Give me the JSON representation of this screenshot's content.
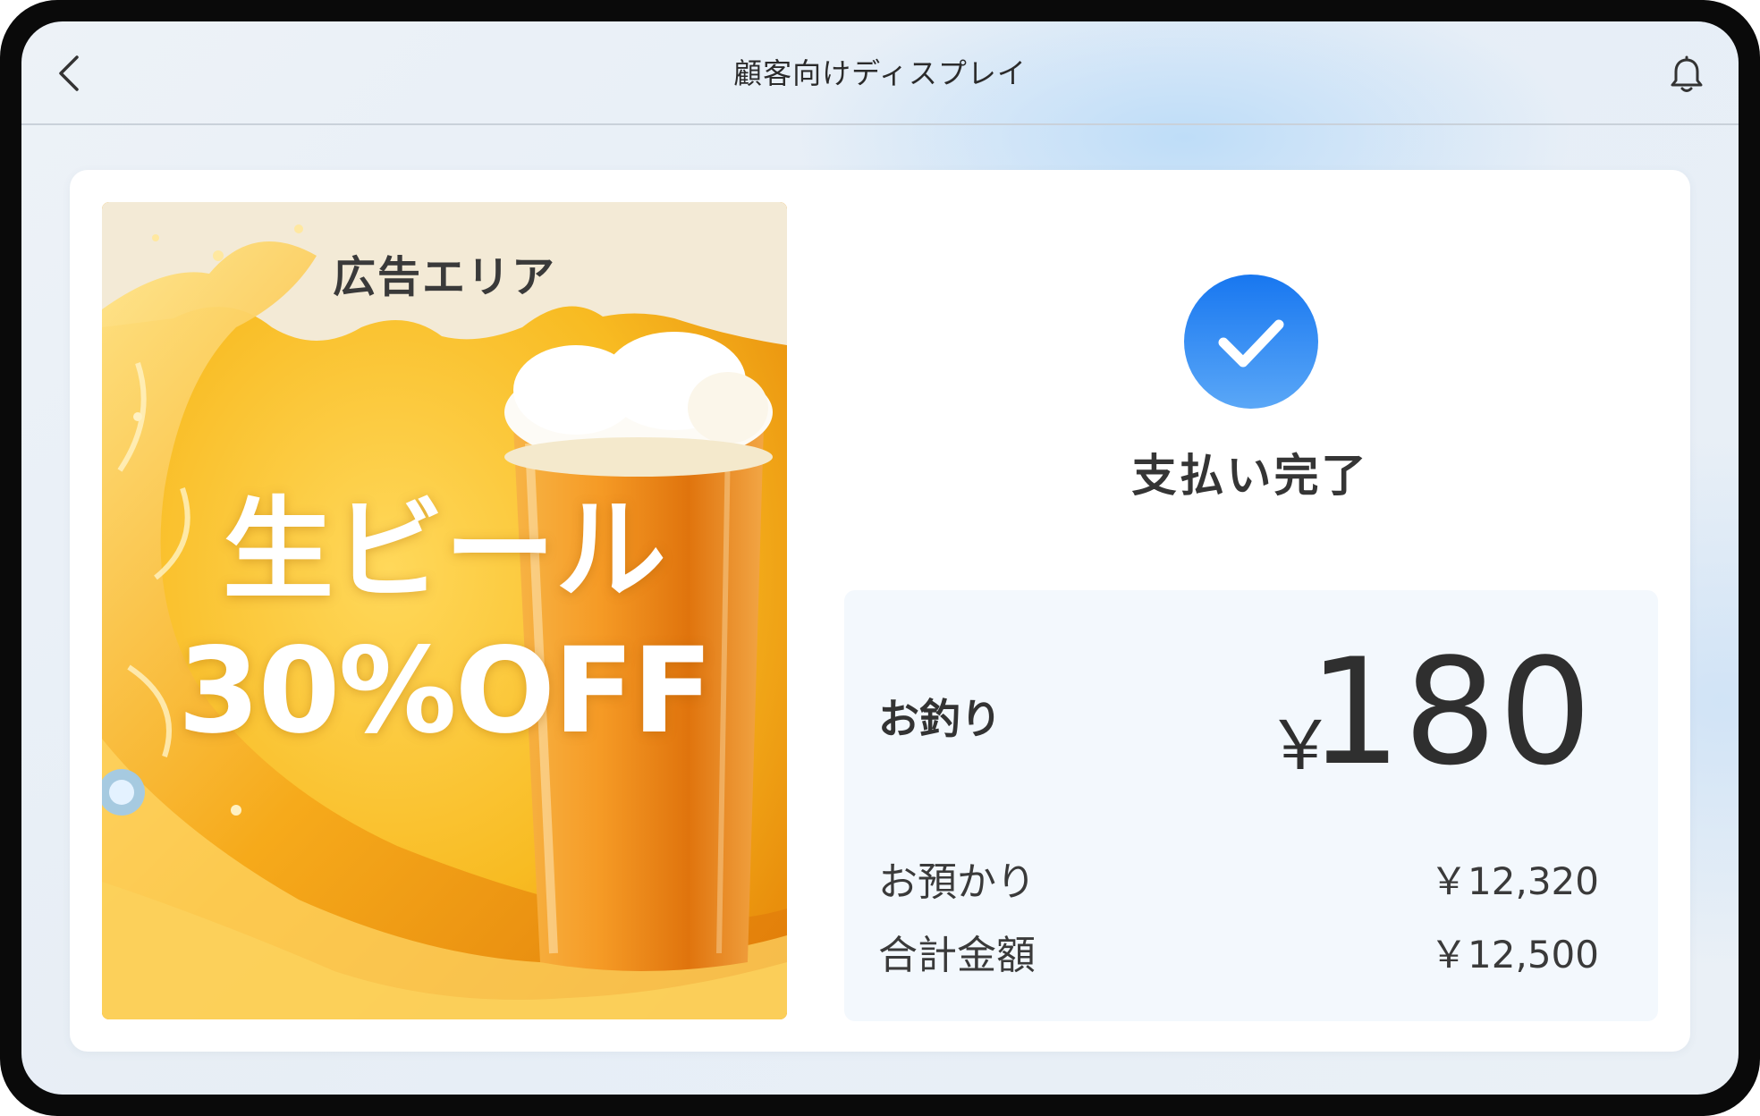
{
  "header": {
    "title": "顧客向けディスプレイ",
    "back_icon": "chevron-left-icon",
    "notification_icon": "bell-icon"
  },
  "ad": {
    "label": "広告エリア",
    "headline": "生ビール",
    "offer": "30%OFF"
  },
  "payment": {
    "status_icon": "check-circle-icon",
    "status": "支払い完了",
    "change_label": "お釣り",
    "change_currency": "￥",
    "change_amount": "180",
    "received_label": "お預かり",
    "received_value": "￥12,320",
    "total_label": "合計金額",
    "total_value": "￥12,500"
  },
  "colors": {
    "accent": "#1e88f5",
    "ad_background": "#f6b21e"
  }
}
